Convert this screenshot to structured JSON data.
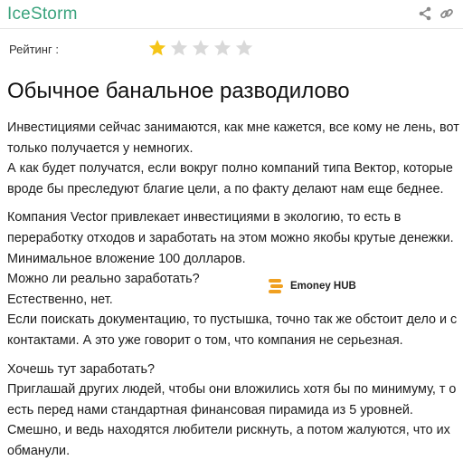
{
  "header": {
    "site_name": "IceStorm",
    "icons": [
      "share-icon",
      "link-icon"
    ]
  },
  "rating": {
    "label": "Рейтинг :",
    "value": 1,
    "max": 5,
    "filled_color": "#f5c518",
    "empty_color": "#d9d9d9"
  },
  "article": {
    "title": "Обычное банальное разводилово",
    "paragraphs": [
      [
        "Инвестициями сейчас занимаются, как мне кажется, все кому не лень, вот",
        "только получается у немногих.",
        "А как будет получатся, если вокруг полно компаний типа Вектор, которые",
        "вроде бы преследуют благие цели, а по факту делают нам еще беднее."
      ],
      [
        "Компания Vector привлекает инвестициями в экологию, то есть в",
        "переработку отходов и заработать на этом можно якобы крутые денежки.",
        "Минимальное вложение 100 долларов.",
        "Можно ли реально заработать?",
        "Естественно, нет.",
        "Если поискать документацию, то пустышка, точно так же обстоит дело и с",
        "контактами. А это уже говорит о том, что компания не серьезная."
      ],
      [
        "Хочешь тут заработать?",
        "Приглашай других людей, чтобы они вложились хотя бы по минимуму, т о",
        "есть перед нами стандартная финансовая пирамида из 5 уровней.",
        "Смешно, и ведь находятся любители рискнуть, а потом жалуются, что их",
        "обманули."
      ]
    ]
  },
  "watermark": {
    "text": "Emoney HUB",
    "logo_color": "#f0a020"
  }
}
